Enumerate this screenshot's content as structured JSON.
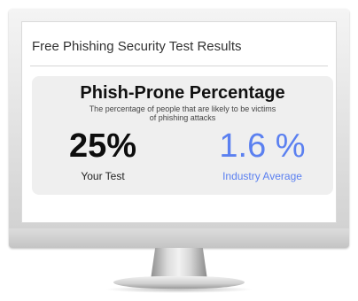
{
  "screen": {
    "header_title": "Free Phishing Security Test Results"
  },
  "card": {
    "title": "Phish-Prone Percentage",
    "subtitle": "The percentage of people that are likely to be victims of phishing attacks",
    "your_test": {
      "value": "25%",
      "label": "Your Test"
    },
    "industry_average": {
      "value": "1.6 %",
      "label": "Industry Average"
    }
  },
  "colors": {
    "industry_accent": "#5b80f0",
    "card_background": "#efefef"
  }
}
